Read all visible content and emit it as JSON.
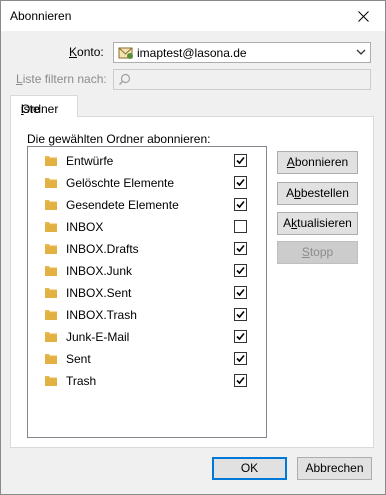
{
  "window": {
    "title": "Abonnieren"
  },
  "account": {
    "label_pre": "",
    "label_u": "K",
    "label_post": "onto:",
    "value": "imaptest@lasona.de"
  },
  "filter": {
    "label_pre": "",
    "label_u": "L",
    "label_post": "iste filtern nach:",
    "value": ""
  },
  "tab": {
    "label_pre": "Ordner",
    "label_u": "l",
    "label_post": "iste"
  },
  "list": {
    "heading": "Die gewählten Ordner abonnieren:",
    "items": [
      {
        "name": "Entwürfe",
        "checked": true
      },
      {
        "name": "Gelöschte Elemente",
        "checked": true
      },
      {
        "name": "Gesendete Elemente",
        "checked": true
      },
      {
        "name": "INBOX",
        "checked": false
      },
      {
        "name": "INBOX.Drafts",
        "checked": true
      },
      {
        "name": "INBOX.Junk",
        "checked": true
      },
      {
        "name": "INBOX.Sent",
        "checked": true
      },
      {
        "name": "INBOX.Trash",
        "checked": true
      },
      {
        "name": "Junk-E-Mail",
        "checked": true
      },
      {
        "name": "Sent",
        "checked": true
      },
      {
        "name": "Trash",
        "checked": true
      }
    ]
  },
  "side_buttons": {
    "subscribe": {
      "pre": "",
      "u": "A",
      "post": "bonnieren"
    },
    "unsubscribe": {
      "pre": "A",
      "u": "b",
      "post": "bestellen"
    },
    "refresh": {
      "pre": "A",
      "u": "k",
      "post": "tualisieren"
    },
    "stop": {
      "pre": "",
      "u": "S",
      "post": "topp"
    }
  },
  "footer": {
    "ok": "OK",
    "cancel": "Abbrechen"
  },
  "colors": {
    "folder": "#e8b84a",
    "folder_dark": "#d9a330",
    "accent": "#0078d7"
  }
}
